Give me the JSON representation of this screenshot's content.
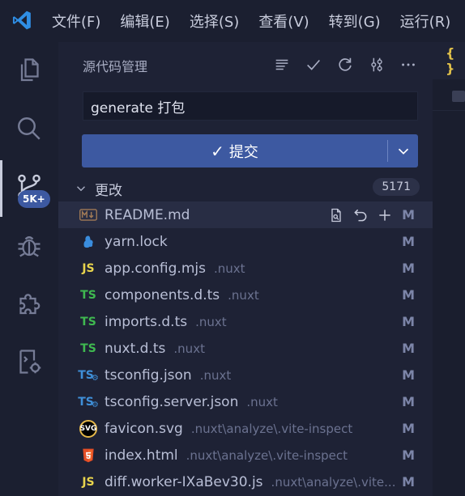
{
  "menu": [
    "文件(F)",
    "编辑(E)",
    "选择(S)",
    "查看(V)",
    "转到(G)",
    "运行(R)"
  ],
  "activity": {
    "badge": "5K+"
  },
  "sidebar": {
    "title": "源代码管理",
    "commit_message": "generate 打包",
    "commit_label": "提交",
    "changes_label": "更改",
    "changes_count": "5171"
  },
  "files": [
    {
      "name": "README.md",
      "dir": "",
      "status": "M",
      "icon": "markdown-icon",
      "badge": "M↓"
    },
    {
      "name": "yarn.lock",
      "dir": "",
      "status": "M",
      "icon": "yarn-icon",
      "badge": ""
    },
    {
      "name": "app.config.mjs",
      "dir": ".nuxt",
      "status": "M",
      "icon": "js-icon",
      "badge": "JS"
    },
    {
      "name": "components.d.ts",
      "dir": ".nuxt",
      "status": "M",
      "icon": "ts-def-icon",
      "badge": "TS"
    },
    {
      "name": "imports.d.ts",
      "dir": ".nuxt",
      "status": "M",
      "icon": "ts-def-icon",
      "badge": "TS"
    },
    {
      "name": "nuxt.d.ts",
      "dir": ".nuxt",
      "status": "M",
      "icon": "ts-def-icon",
      "badge": "TS"
    },
    {
      "name": "tsconfig.json",
      "dir": ".nuxt",
      "status": "M",
      "icon": "tsconfig-icon",
      "badge": "TS"
    },
    {
      "name": "tsconfig.server.json",
      "dir": ".nuxt",
      "status": "M",
      "icon": "tsconfig-icon",
      "badge": "TS"
    },
    {
      "name": "favicon.svg",
      "dir": ".nuxt\\analyze\\.vite-inspect",
      "status": "M",
      "icon": "svg-icon",
      "badge": "SVG"
    },
    {
      "name": "index.html",
      "dir": ".nuxt\\analyze\\.vite-inspect",
      "status": "M",
      "icon": "html5-icon",
      "badge": "5"
    },
    {
      "name": "diff.worker-IXaBev30.js",
      "dir": ".nuxt\\analyze\\.vite...",
      "status": "M",
      "icon": "js-icon",
      "badge": "JS"
    }
  ],
  "editor": {
    "tab_glyph": "{ }"
  },
  "colors": {
    "accent": "#3d59a1",
    "ts": "#3fb950",
    "js": "#e8d44d",
    "html": "#e44d26"
  }
}
